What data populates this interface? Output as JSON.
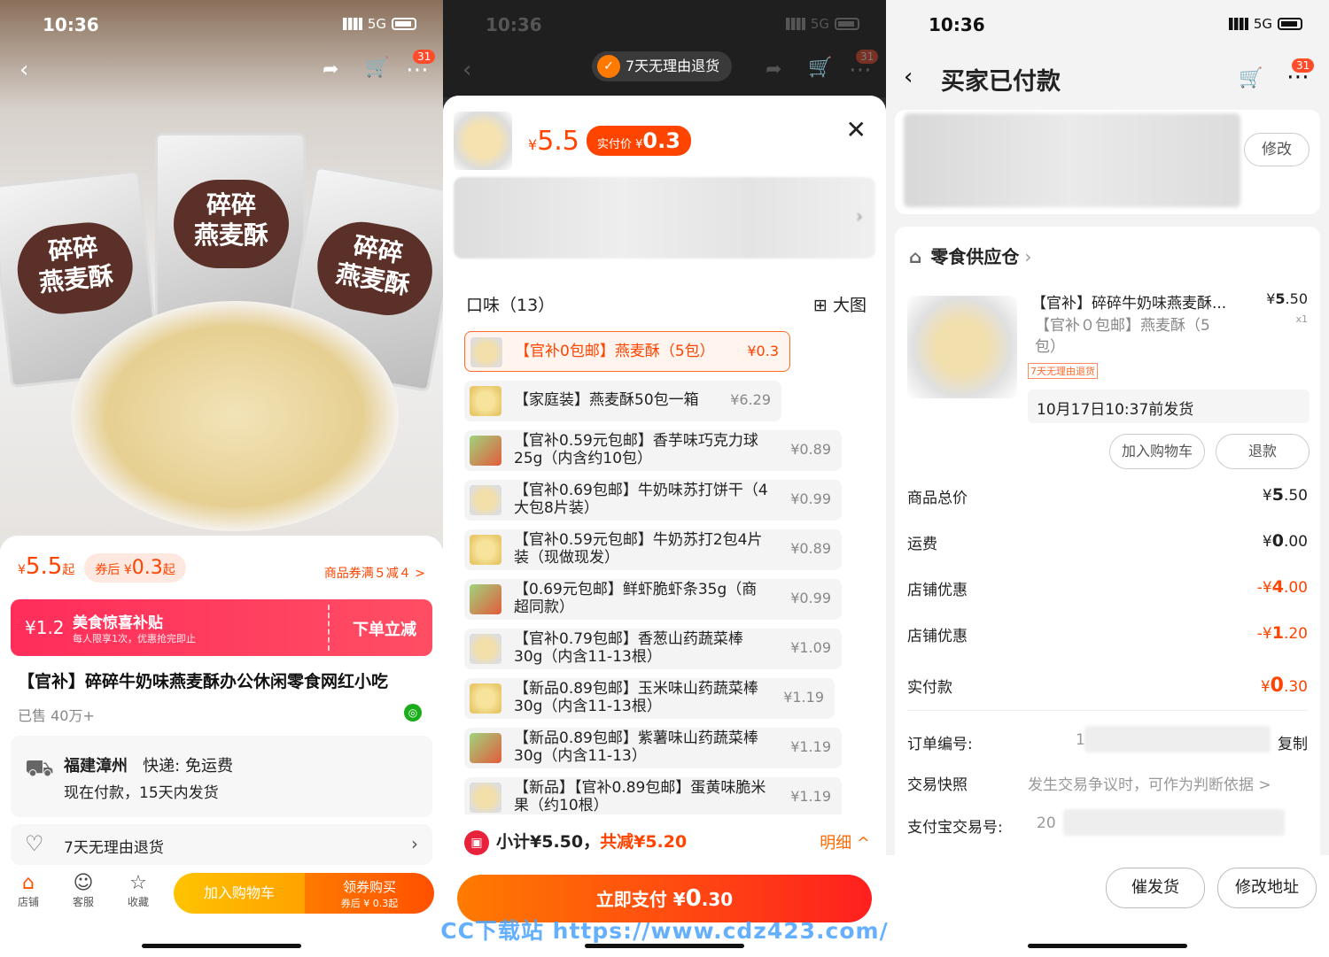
{
  "status": {
    "time": "10:36",
    "network": "5G"
  },
  "p1": {
    "badge": "31",
    "bag_text": [
      "碎碎",
      "燕麦酥"
    ],
    "price": "5.5",
    "price_unit": "¥",
    "price_suffix": "起",
    "coupon_label": "券后 ¥",
    "coupon_price": "0.3",
    "coupon_suffix": "起",
    "coupon_link": "商品券满５减４ >",
    "subsidy_amount": "¥1.2",
    "subsidy_title": "美食惊喜补贴",
    "subsidy_sub": "每人限享1次，优惠抢完即止",
    "subsidy_cta": "下单立减",
    "title": "【官补】碎碎牛奶味燕麦酥办公休闲零食网红小吃",
    "sold": "已售 40万+",
    "origin": "福建漳州",
    "express": "快递: 免运费",
    "ship_note": "现在付款，15天内发货",
    "return_policy": "7天无理由退货",
    "bottom": {
      "shop": "店铺",
      "service": "客服",
      "fav": "收藏",
      "add_cart": "加入购物车",
      "buy": "领券购买",
      "buy_sub": "券后 ¥ 0.3起"
    }
  },
  "p2": {
    "badge": "31",
    "return_pill": "7天无理由退货",
    "price_unit": "¥",
    "price": "5.5",
    "paid_label": "实付价 ¥",
    "paid_price": "0.3",
    "flavor_title": "口味（13）",
    "big_view": "大图",
    "options": [
      {
        "name": "【官补0包邮】燕麦酥（5包）",
        "price": "¥0.3",
        "selected": true
      },
      {
        "name": "【家庭装】燕麦酥50包一箱",
        "price": "¥6.29"
      },
      {
        "name": "【官补0.59元包邮】香芋味巧克力球25g（内含约10包）",
        "price": "¥0.89"
      },
      {
        "name": "【官补0.69包邮】牛奶味苏打饼干（4大包8片装）",
        "price": "¥0.99"
      },
      {
        "name": "【官补0.59元包邮】牛奶苏打2包4片装（现做现发）",
        "price": "¥0.89"
      },
      {
        "name": "【0.69元包邮】鲜虾脆虾条35g（商超同款）",
        "price": "¥0.99"
      },
      {
        "name": "【官补0.79包邮】香葱山药蔬菜棒30g（内含11-13根）",
        "price": "¥1.09"
      },
      {
        "name": "【新品0.89包邮】玉米味山药蔬菜棒30g（内含11-13根）",
        "price": "¥1.19"
      },
      {
        "name": "【新品0.89包邮】紫薯味山药蔬菜棒30g（内含11-13）",
        "price": "¥1.19"
      },
      {
        "name": "【新品】【官补0.89包邮】蛋黄味脆米果（约10根）",
        "price": "¥1.19"
      }
    ],
    "subtotal": "小计¥5.50，",
    "discount": "共减¥5.20",
    "detail": "明细 ^",
    "pay_label": "立即支付 ¥",
    "pay_amount": "0",
    "pay_decimal": ".30"
  },
  "p3": {
    "title": "买家已付款",
    "badge": "31",
    "modify": "修改",
    "shop": "零食供应仓",
    "item_name": "【官补】碎碎牛奶味燕麦酥...",
    "item_price_unit": "¥",
    "item_price": "5",
    "item_price_dec": ".50",
    "item_qty": "x1",
    "item_spec": "【官补０包邮】燕麦酥（5包）",
    "item_tag": "7天无理由退货",
    "ship_time": "10月17日10:37前发货",
    "add_cart": "加入购物车",
    "refund": "退款",
    "summary": [
      {
        "label": "商品总价",
        "prefix": "¥",
        "int": "5",
        "dec": ".50",
        "red": false
      },
      {
        "label": "运费",
        "prefix": "¥",
        "int": "0",
        "dec": ".00",
        "red": false
      },
      {
        "label": "店铺优惠",
        "prefix": "-¥",
        "int": "4",
        "dec": ".00",
        "red": true
      },
      {
        "label": "店铺优惠",
        "prefix": "-¥",
        "int": "1",
        "dec": ".20",
        "red": true
      },
      {
        "label": "实付款",
        "prefix": "¥",
        "int": "0",
        "dec": ".30",
        "red": true
      }
    ],
    "order_no_label": "订单编号:",
    "order_no_partial": "1",
    "copy": "复制",
    "snapshot_label": "交易快照",
    "snapshot_text": "发生交易争议时，可作为判断依据 >",
    "alipay_label": "支付宝交易号:",
    "alipay_partial": "20",
    "remind": "催发货",
    "change_addr": "修改地址"
  },
  "watermark": "CC下载站 https://www.cdz423.com/",
  "colors": {
    "accent": "#ff4400",
    "subsidy": "#ff2d5a",
    "pay_gradient_start": "#ff7b00",
    "pay_gradient_end": "#ff1f1f"
  }
}
